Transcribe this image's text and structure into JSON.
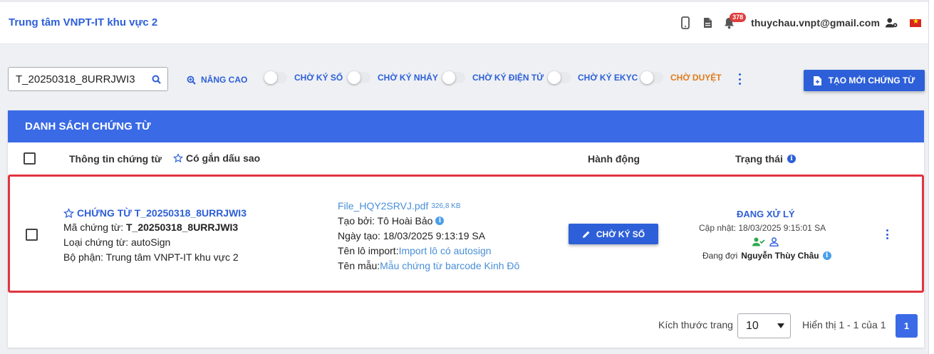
{
  "header": {
    "brand": "Trung tâm VNPT-IT khu vực 2",
    "notification_count": "378",
    "email": "thuychau.vnpt@gmail.com",
    "icons": [
      "mobile-icon",
      "document-icon",
      "bell-icon",
      "user-gear-icon",
      "vietnam-flag-icon"
    ]
  },
  "toolbar": {
    "search_value": "T_20250318_8URRJWI3",
    "advanced_label": "NÂNG CAO",
    "filters": [
      {
        "label": "CHỜ KÝ SỐ",
        "on": false,
        "color": "#2d5fd8"
      },
      {
        "label": "CHỜ KÝ NHÁY",
        "on": false,
        "color": "#2d5fd8"
      },
      {
        "label": "CHỜ KÝ ĐIỆN TỬ",
        "on": false,
        "color": "#2d5fd8"
      },
      {
        "label": "CHỜ KÝ EKYC",
        "on": false,
        "color": "#2d5fd8"
      },
      {
        "label": "CHỜ DUYỆT",
        "on": false,
        "color": "#e07b1a"
      }
    ],
    "create_label": "TẠO MỚI CHỨNG TỪ"
  },
  "list": {
    "title": "DANH SÁCH CHỨNG TỪ",
    "columns": {
      "info": "Thông tin chứng từ",
      "starred": "Có gắn dấu sao",
      "action": "Hành động",
      "status": "Trạng thái"
    },
    "rows": [
      {
        "title": "CHỨNG TỪ T_20250318_8URRJWI3",
        "code_label": "Mã chứng từ: ",
        "code": "T_20250318_8URRJWI3",
        "type": "Loại chứng từ: autoSign",
        "department": "Bộ phận: Trung tâm VNPT-IT khu vực 2",
        "file_name": "File_HQY2SRVJ.pdf",
        "file_size": "326,8 KB",
        "created_by": "Tạo bởi: Tô Hoài Bảo",
        "created_at": "Ngày tạo: 18/03/2025 9:13:19 SA",
        "batch_label": "Tên lô import: ",
        "batch": "Import lô có autosign",
        "template_label": "Tên mẫu: ",
        "template": "Mẫu chứng từ barcode Kinh Đô",
        "action_label": "CHỜ KÝ SỐ",
        "status": "ĐANG XỬ LÝ",
        "updated": "Cập nhật: 18/03/2025 9:15:01 SA",
        "waiting_label": "Đang đợi",
        "waiting_user": "Nguyễn Thùy Châu"
      }
    ]
  },
  "pagination": {
    "page_size_label": "Kích thước trang",
    "page_size": "10",
    "showing": "Hiển thị 1 - 1 của 1",
    "current_page": "1"
  },
  "colors": {
    "primary": "#2d5fd8",
    "header_band": "#3a6ae6",
    "highlight_border": "#e03541",
    "pending_orange": "#e07b1a"
  }
}
